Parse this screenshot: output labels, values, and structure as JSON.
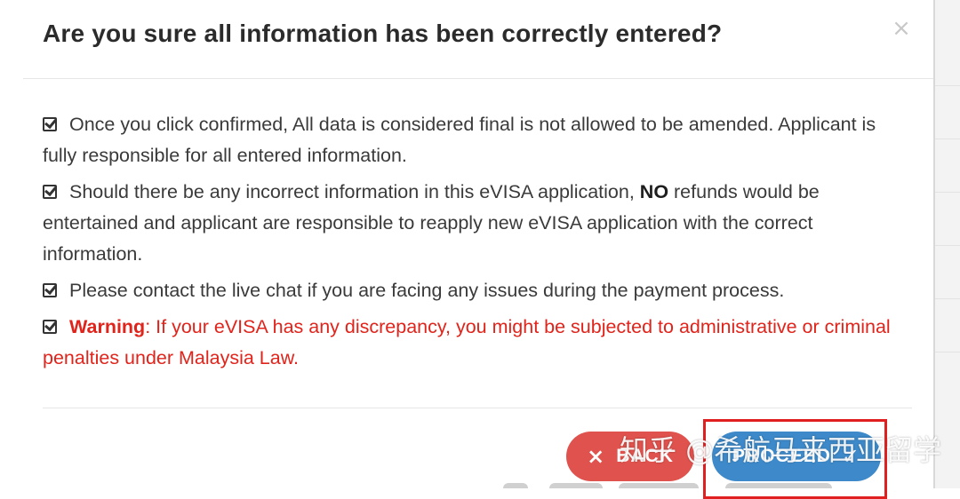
{
  "dialog": {
    "title": "Are you sure all information has been correctly entered?",
    "close_label": "×",
    "items": [
      {
        "text": "Once you click confirmed, All data is considered final is not allowed to be amended. Applicant is fully responsible for all entered information."
      },
      {
        "text_before": "Should there be any incorrect information in this eVISA application, ",
        "bold": "NO",
        "text_after": " refunds would be entertained and applicant are responsible to reapply new eVISA application with the correct information."
      },
      {
        "text": "Please contact the live chat if you are facing any issues during the payment process."
      },
      {
        "label": "Warning",
        "text": ": If your eVISA has any discrepancy, you might be subjected to administrative or criminal penalties under Malaysia Law."
      }
    ],
    "buttons": {
      "back": {
        "label": "BACK",
        "icon": "×"
      },
      "proceed": {
        "label": "PROCEED",
        "icon": "✓"
      }
    }
  },
  "watermark": {
    "text": "知乎 @希航马来西亚留学"
  },
  "colors": {
    "back_button": "#e0524d",
    "proceed_button": "#3d89c9",
    "warning_text": "#e0241b",
    "highlight_box": "#e02020"
  }
}
